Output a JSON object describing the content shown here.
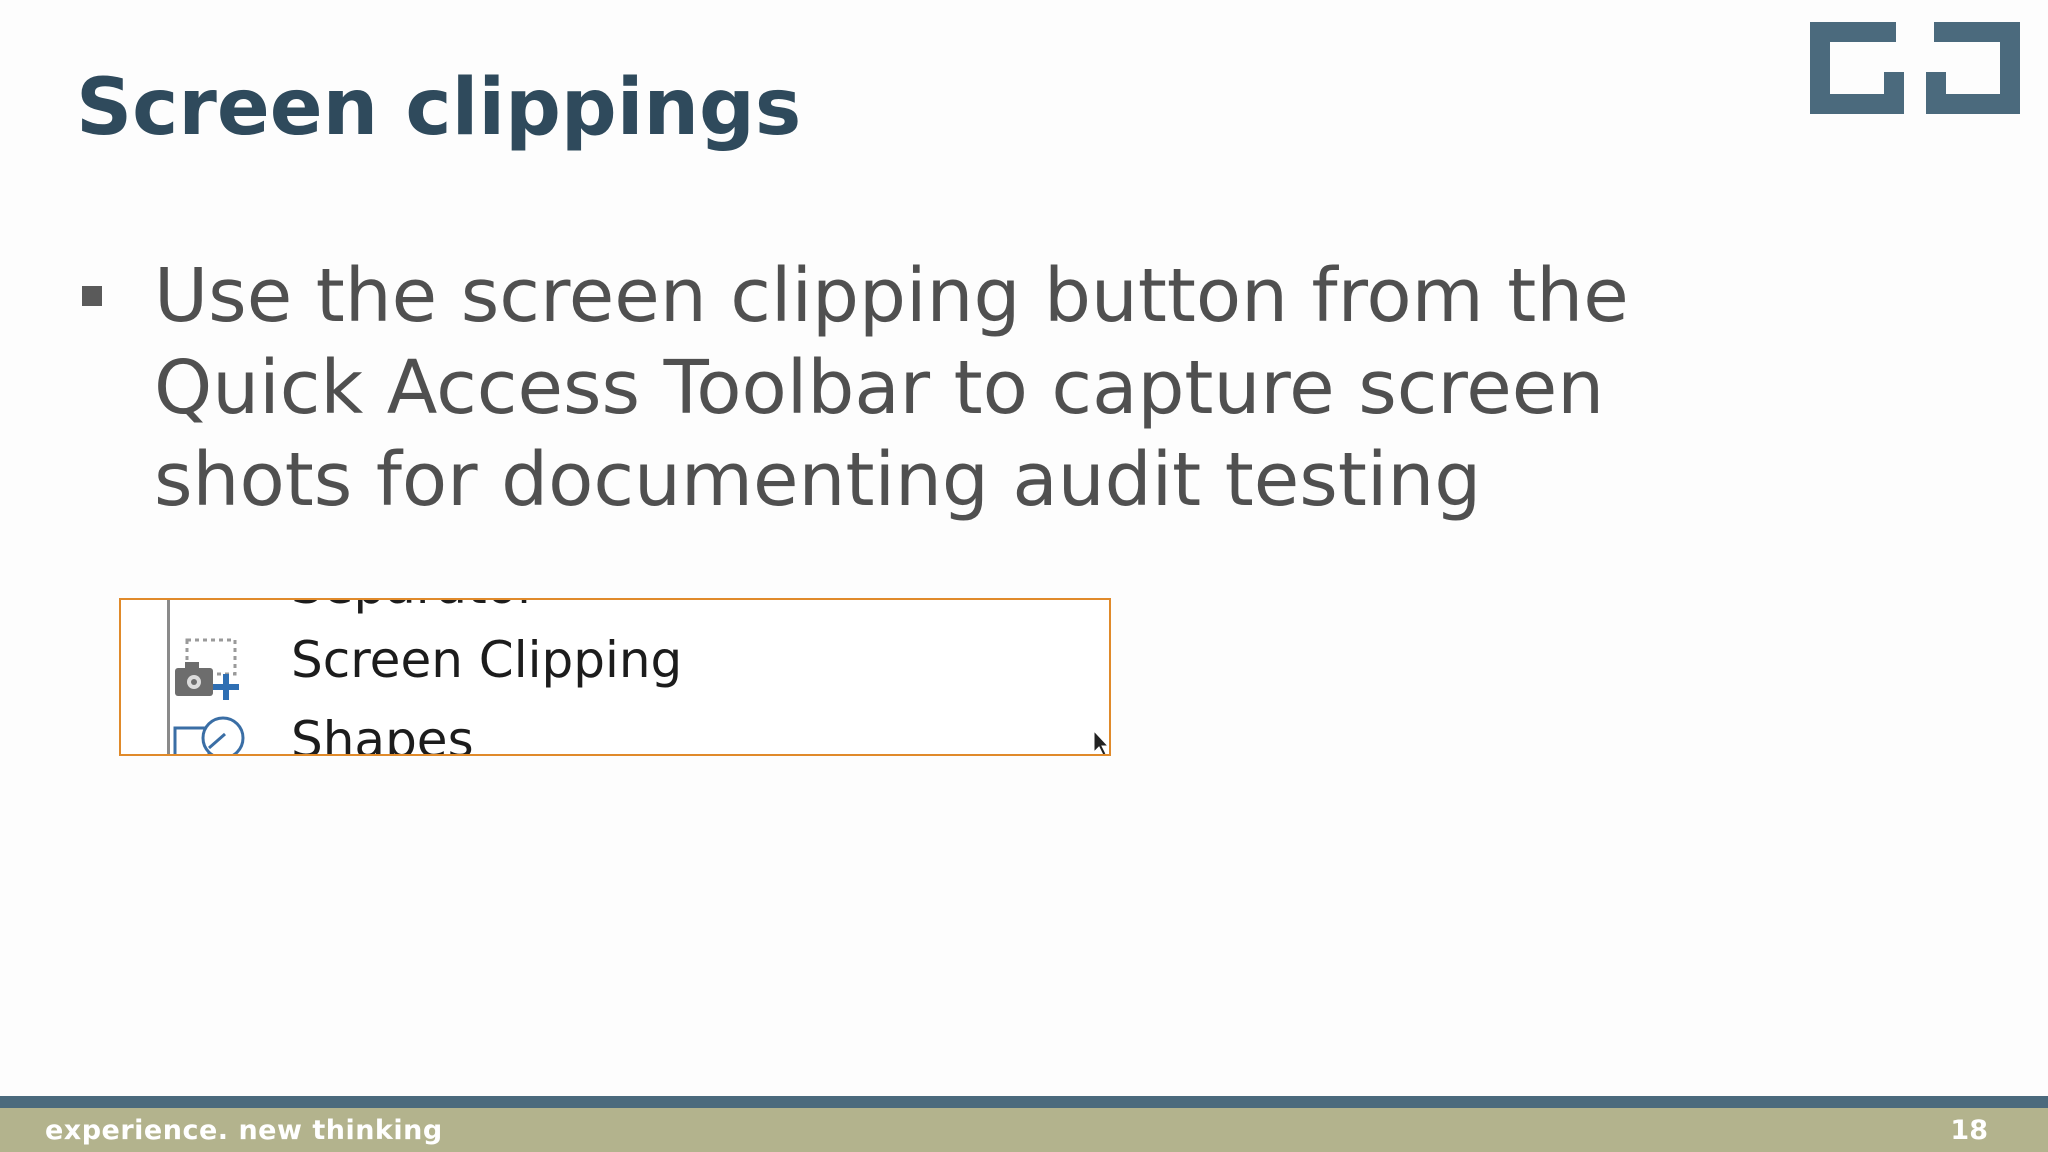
{
  "slide": {
    "title": "Screen clippings",
    "bullets": [
      {
        "lines": [
          "Use the screen clipping button from the",
          "Quick Access Toolbar to capture screen",
          "shots for documenting audit testing"
        ]
      }
    ],
    "page_number": "18"
  },
  "clipping": {
    "previous_item_label": "Separator",
    "item_label": "Screen Clipping",
    "next_item_label": "Shapes",
    "icons": [
      "camera-add-icon",
      "shapes-icon",
      "cursor-icon"
    ]
  },
  "footer": {
    "tagline": "experience. new thinking"
  },
  "colors": {
    "title": "#2f4a5c",
    "body_text": "#505050",
    "logo": "#4b6a7d",
    "clip_border": "#e08a2a",
    "footer_band": "#4b6a7d",
    "footer_bg": "#b3b38d"
  },
  "logo": {
    "icon": "company-logo"
  }
}
